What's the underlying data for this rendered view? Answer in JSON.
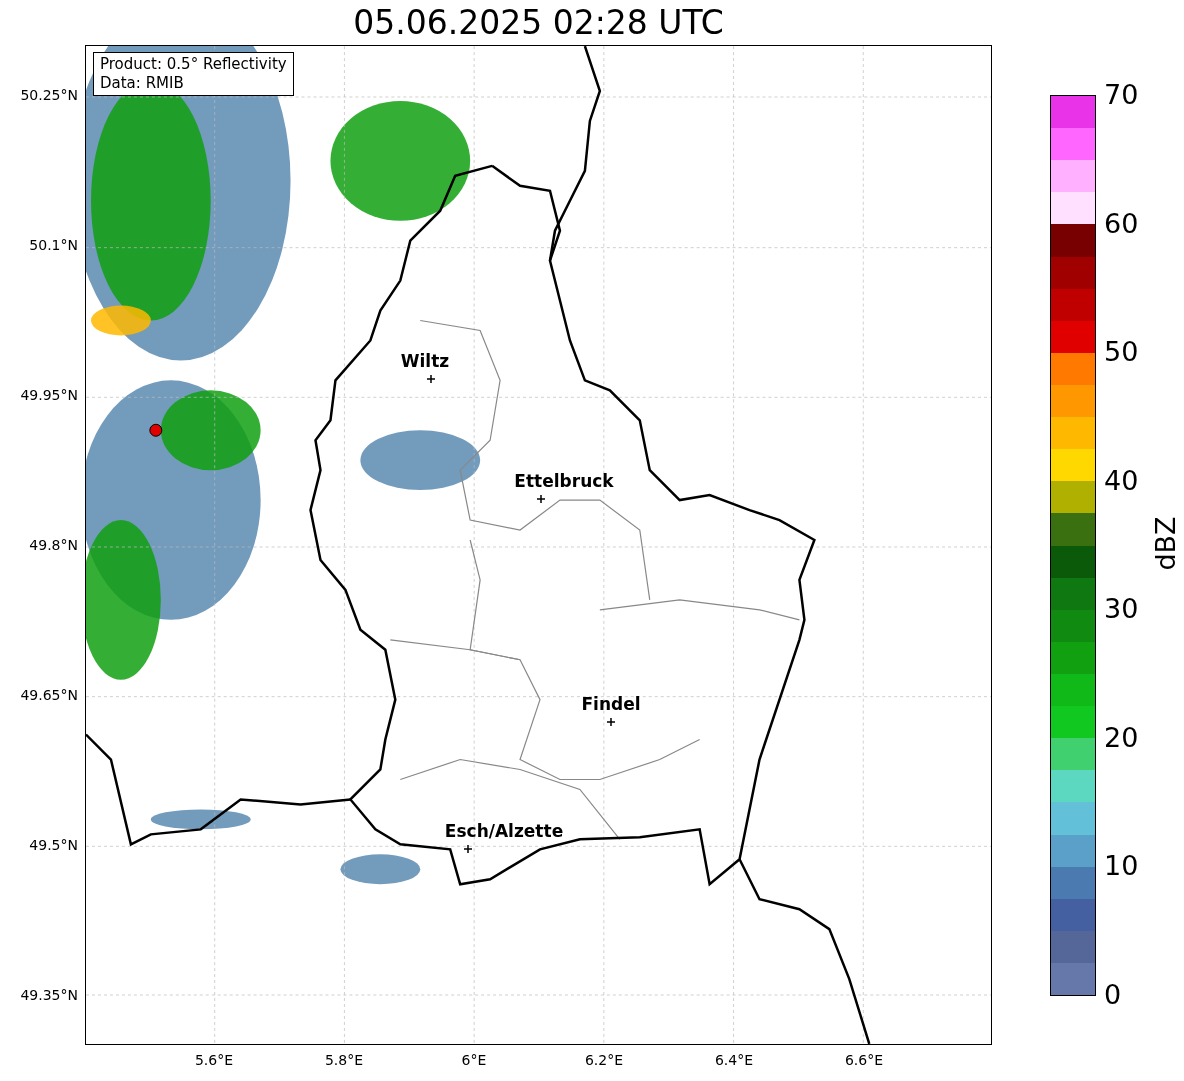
{
  "title": "05.06.2025 02:28 UTC",
  "info_box": {
    "lines": [
      "Product: 0.5° Reflectivity",
      "Data: RMIB"
    ]
  },
  "y_ticks": [
    "50.25°N",
    "50.1°N",
    "49.95°N",
    "49.8°N",
    "49.65°N",
    "49.5°N",
    "49.35°N"
  ],
  "x_ticks": [
    "5.6°E",
    "5.8°E",
    "6°E",
    "6.2°E",
    "6.4°E",
    "6.6°E"
  ],
  "cities": [
    {
      "name": "Wiltz"
    },
    {
      "name": "Ettelbruck"
    },
    {
      "name": "Findel"
    },
    {
      "name": "Esch/Alzette"
    }
  ],
  "colorbar": {
    "label": "dBZ",
    "ticks": [
      "70",
      "60",
      "50",
      "40",
      "30",
      "20",
      "10",
      "0"
    ],
    "segments": [
      {
        "color": "#e833e8"
      },
      {
        "color": "#ff66ff"
      },
      {
        "color": "#ffb0ff"
      },
      {
        "color": "#ffe0ff"
      },
      {
        "color": "#780000"
      },
      {
        "color": "#a00000"
      },
      {
        "color": "#c00000"
      },
      {
        "color": "#e00000"
      },
      {
        "color": "#ff7800"
      },
      {
        "color": "#ff9800"
      },
      {
        "color": "#ffb800"
      },
      {
        "color": "#ffd800"
      },
      {
        "color": "#b0b000"
      },
      {
        "color": "#3a7010"
      },
      {
        "color": "#0a5a0a"
      },
      {
        "color": "#107810"
      },
      {
        "color": "#108a10"
      },
      {
        "color": "#10a010"
      },
      {
        "color": "#10b818"
      },
      {
        "color": "#10c820"
      },
      {
        "color": "#40d070"
      },
      {
        "color": "#5cd8c0"
      },
      {
        "color": "#62c0d8"
      },
      {
        "color": "#5aa0c8"
      },
      {
        "color": "#4a7ab0"
      },
      {
        "color": "#4460a0"
      },
      {
        "color": "#556699"
      },
      {
        "color": "#6677aa"
      }
    ]
  }
}
